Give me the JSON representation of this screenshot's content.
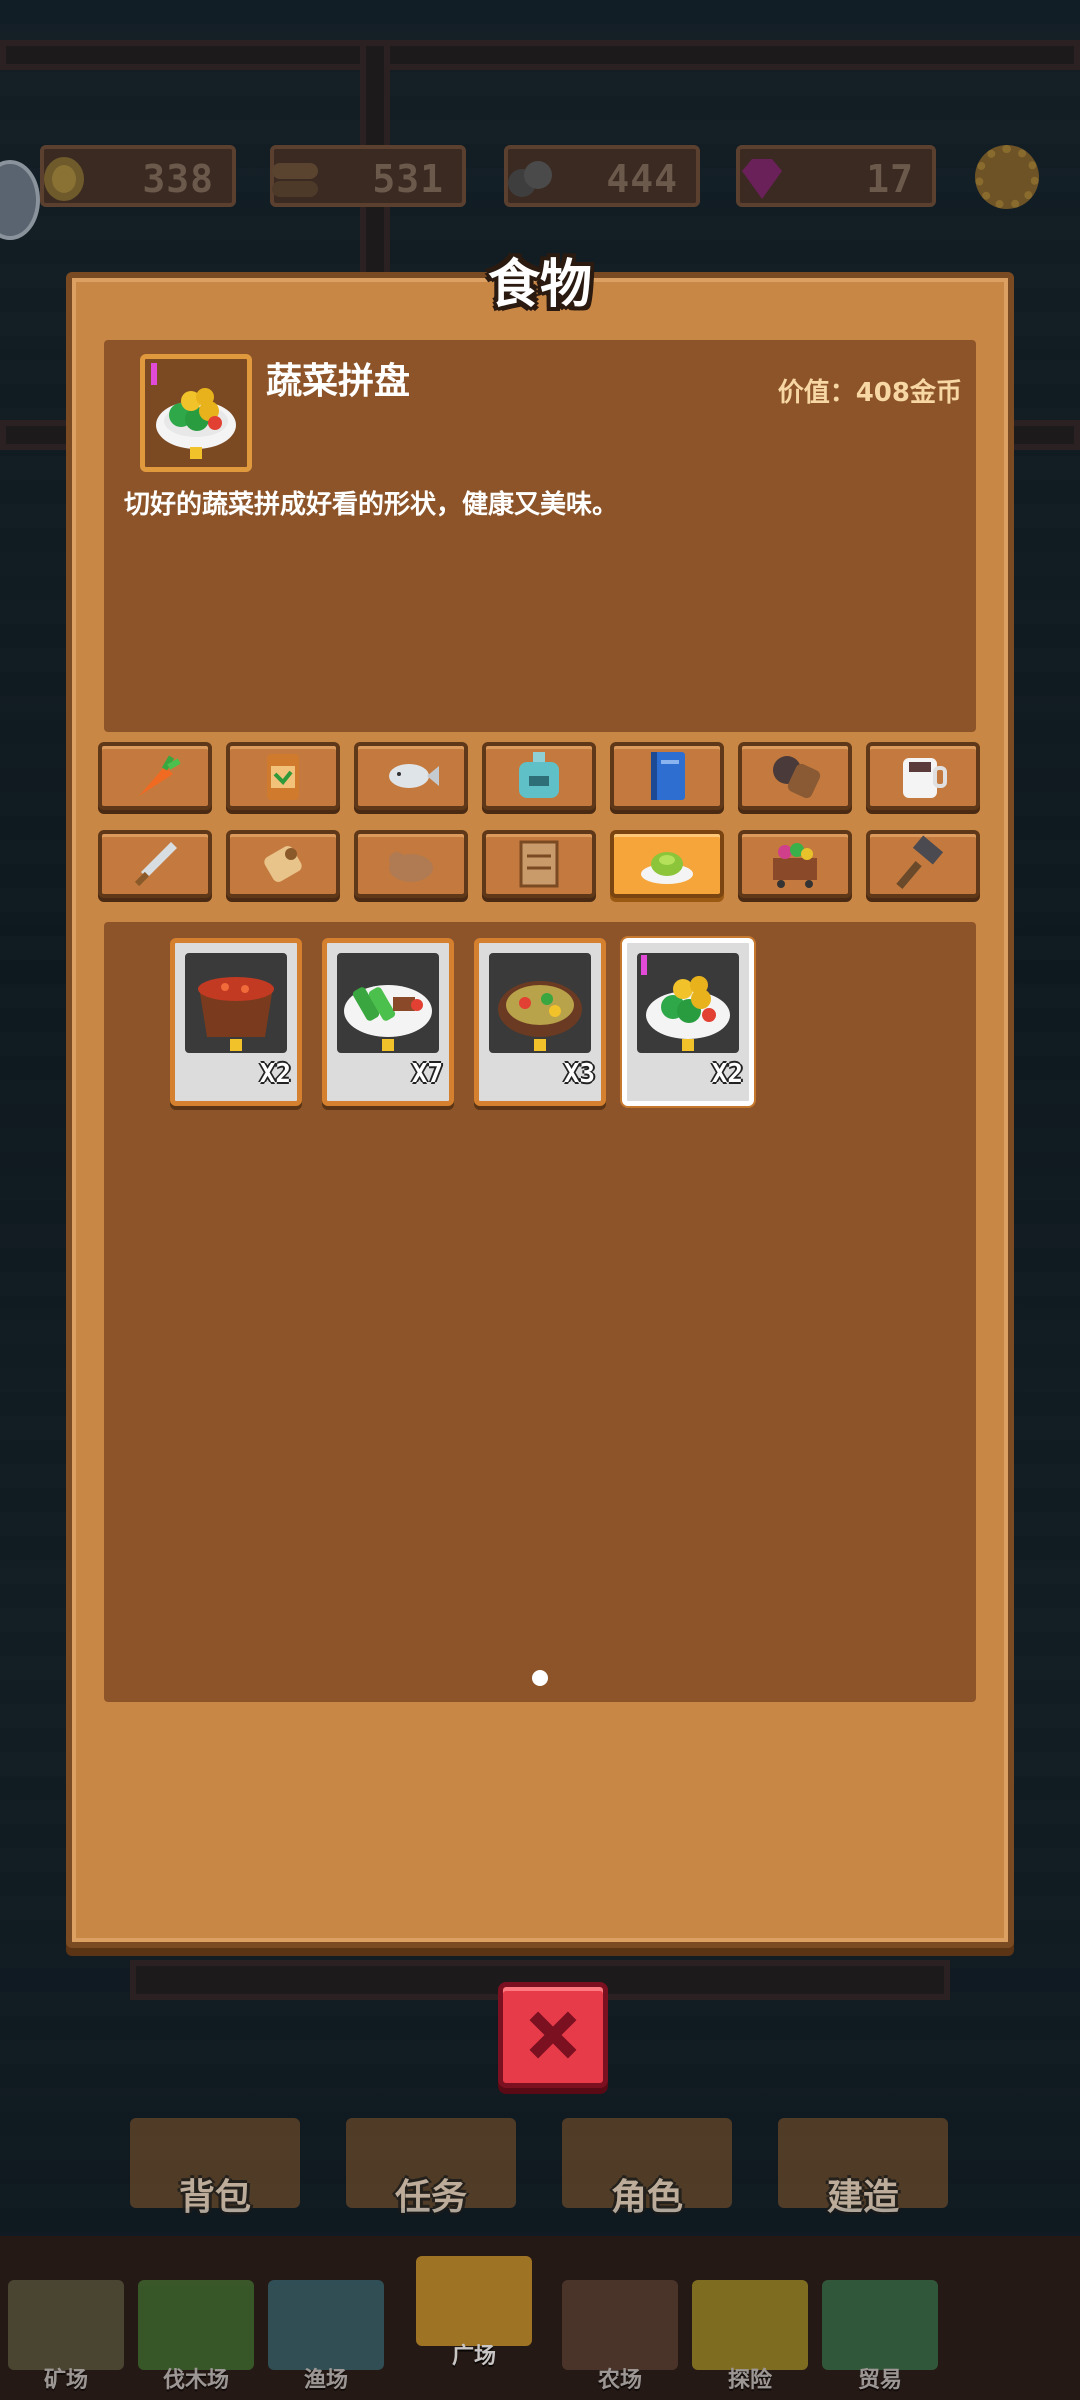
{
  "resources": [
    {
      "name": "gold",
      "icon": "gold-coin-icon",
      "value": "338"
    },
    {
      "name": "wood",
      "icon": "wood-log-icon",
      "value": "531"
    },
    {
      "name": "stone",
      "icon": "stone-icon",
      "value": "444"
    },
    {
      "name": "gem",
      "icon": "gem-icon",
      "value": "17"
    }
  ],
  "panel": {
    "title": "食物"
  },
  "detail": {
    "name": "蔬菜拼盘",
    "value": "价值：408金币",
    "description": "切好的蔬菜拼成好看的形状，健康又美味。"
  },
  "categories": [
    {
      "icon": "carrot-icon"
    },
    {
      "icon": "seed-bag-icon"
    },
    {
      "icon": "fish-icon"
    },
    {
      "icon": "potion-icon"
    },
    {
      "icon": "book-icon"
    },
    {
      "icon": "bark-log-icon"
    },
    {
      "icon": "cup-icon"
    },
    {
      "icon": "sword-icon"
    },
    {
      "icon": "scroll-icon"
    },
    {
      "icon": "animal-icon"
    },
    {
      "icon": "frame-icon"
    },
    {
      "icon": "food-dish-icon",
      "active": true
    },
    {
      "icon": "ore-cart-icon"
    },
    {
      "icon": "hammer-icon"
    }
  ],
  "items": [
    {
      "icon": "tomato-stew-icon",
      "quantity": "X2"
    },
    {
      "icon": "vegetable-skewer-icon",
      "quantity": "X7"
    },
    {
      "icon": "soup-bowl-icon",
      "quantity": "X3"
    },
    {
      "icon": "vegetable-platter-icon",
      "quantity": "X2",
      "selected": true
    }
  ],
  "bottom_menu": [
    {
      "label": "背包"
    },
    {
      "label": "任务"
    },
    {
      "label": "角色"
    },
    {
      "label": "建造"
    }
  ],
  "nav": [
    {
      "label": "矿场"
    },
    {
      "label": "伐木场"
    },
    {
      "label": "渔场"
    },
    {
      "label": "广场",
      "active": true
    },
    {
      "label": "农场"
    },
    {
      "label": "探险"
    },
    {
      "label": "贸易"
    }
  ],
  "colors": {
    "panel": "#c98746",
    "panel_inner": "#8c5428",
    "active_tab": "#f6a53a",
    "close_button": "#e83b4a"
  }
}
